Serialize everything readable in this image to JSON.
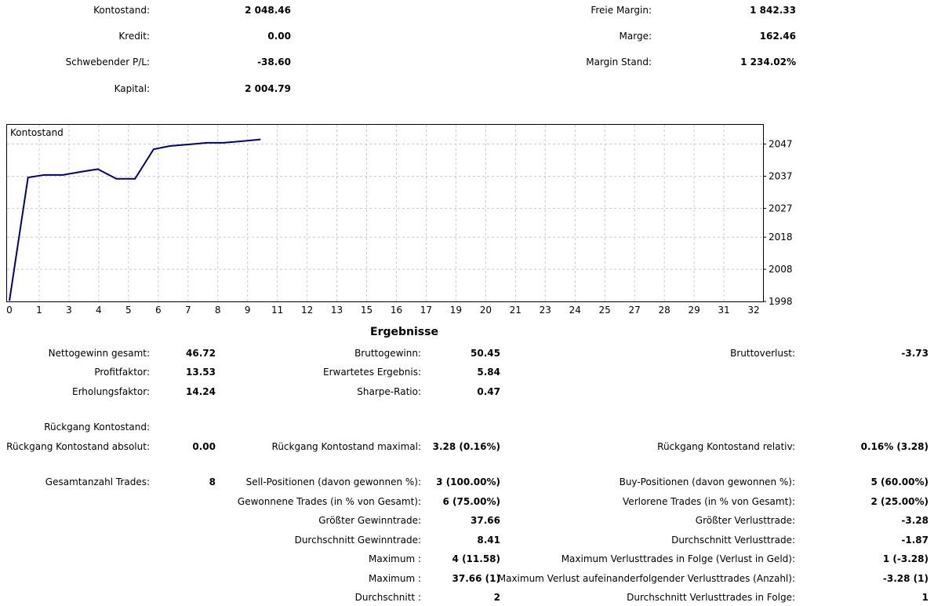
{
  "summary": {
    "left": [
      {
        "label": "Kontostand:",
        "value": "2 048.46"
      },
      {
        "label": "Kredit:",
        "value": "0.00"
      },
      {
        "label": "Schwebender P/L:",
        "value": "-38.60"
      },
      {
        "label": "Kapital:",
        "value": "2 004.79"
      }
    ],
    "right": [
      {
        "label": "Freie Margin:",
        "value": "1 842.33"
      },
      {
        "label": "Marge:",
        "value": "162.46"
      },
      {
        "label": "Margin Stand:",
        "value": "1 234.02%"
      }
    ]
  },
  "chart_data": {
    "type": "line",
    "title": "Kontostand",
    "x_ticks": [
      0,
      1,
      3,
      4,
      5,
      6,
      7,
      8,
      9,
      11,
      12,
      13,
      15,
      16,
      17,
      19,
      20,
      21,
      23,
      24,
      25,
      27,
      28,
      29,
      31,
      32
    ],
    "y_ticks": [
      1998,
      2008,
      2018,
      2027,
      2037,
      2047
    ],
    "ylim": [
      1998,
      2053
    ],
    "grid": true,
    "series": [
      {
        "x": [
          0,
          0.8,
          1.5,
          2.3,
          3.1,
          3.8,
          4.6,
          5.4,
          6.2,
          6.9,
          7.7,
          8.5,
          9.2,
          10.0,
          10.8
        ],
        "values": [
          1998.2,
          2036.6,
          2037.4,
          2037.4,
          2038.4,
          2039.2,
          2036.2,
          2036.2,
          2045.4,
          2046.4,
          2046.9,
          2047.4,
          2047.4,
          2047.9,
          2048.46
        ]
      }
    ],
    "color": "#000080"
  },
  "results": {
    "title": "Ergebnisse",
    "col1": [
      {
        "label": "Nettogewinn gesamt:",
        "value": "46.72"
      },
      {
        "label": "Profitfaktor:",
        "value": "13.53"
      },
      {
        "label": "Erholungsfaktor:",
        "value": "14.24"
      }
    ],
    "col2": [
      {
        "label": "Bruttogewinn:",
        "value": "50.45"
      },
      {
        "label": "Erwartetes Ergebnis:",
        "value": "5.84"
      },
      {
        "label": "Sharpe-Ratio:",
        "value": "0.47"
      }
    ],
    "col3": [
      {
        "label": "Bruttoverlust:",
        "value": "-3.73"
      }
    ],
    "drawdown_header": "Rückgang Kontostand:",
    "drawdown": {
      "abs_label": "Rückgang Kontostand absolut:",
      "abs_value": "0.00",
      "max_label": "Rückgang Kontostand maximal:",
      "max_value": "3.28 (0.16%)",
      "rel_label": "Rückgang Kontostand relativ:",
      "rel_value": "0.16% (3.28)"
    },
    "total_trades_label": "Gesamtanzahl Trades:",
    "total_trades_value": "8",
    "trades_mid": [
      {
        "label": "Sell-Positionen (davon gewonnen %):",
        "value": "3 (100.00%)"
      },
      {
        "label": "Gewonnene Trades (in % von Gesamt):",
        "value": "6 (75.00%)"
      },
      {
        "label": "Größter Gewinntrade:",
        "value": "37.66"
      },
      {
        "label": "Durchschnitt Gewinntrade:",
        "value": "8.41"
      },
      {
        "label": "Maximum :",
        "value": "4 (11.58)"
      },
      {
        "label": "Maximum :",
        "value": "37.66 (1)"
      },
      {
        "label": "Durchschnitt :",
        "value": "2"
      }
    ],
    "trades_right": [
      {
        "label": "Buy-Positionen (davon gewonnen %):",
        "value": "5 (60.00%)"
      },
      {
        "label": "Verlorene Trades (in % von Gesamt):",
        "value": "2 (25.00%)"
      },
      {
        "label": "Größter Verlusttrade:",
        "value": "-3.28"
      },
      {
        "label": "Durchschnitt Verlusttrade:",
        "value": "-1.87"
      },
      {
        "label": "Maximum Verlusttrades in Folge (Verlust in Geld):",
        "value": "1 (-3.28)"
      },
      {
        "label": "Maximum Verlust aufeinanderfolgender Verlusttrades (Anzahl):",
        "value": "-3.28 (1)"
      },
      {
        "label": "Durchschnitt Verlusttrades in Folge:",
        "value": "1"
      }
    ]
  }
}
